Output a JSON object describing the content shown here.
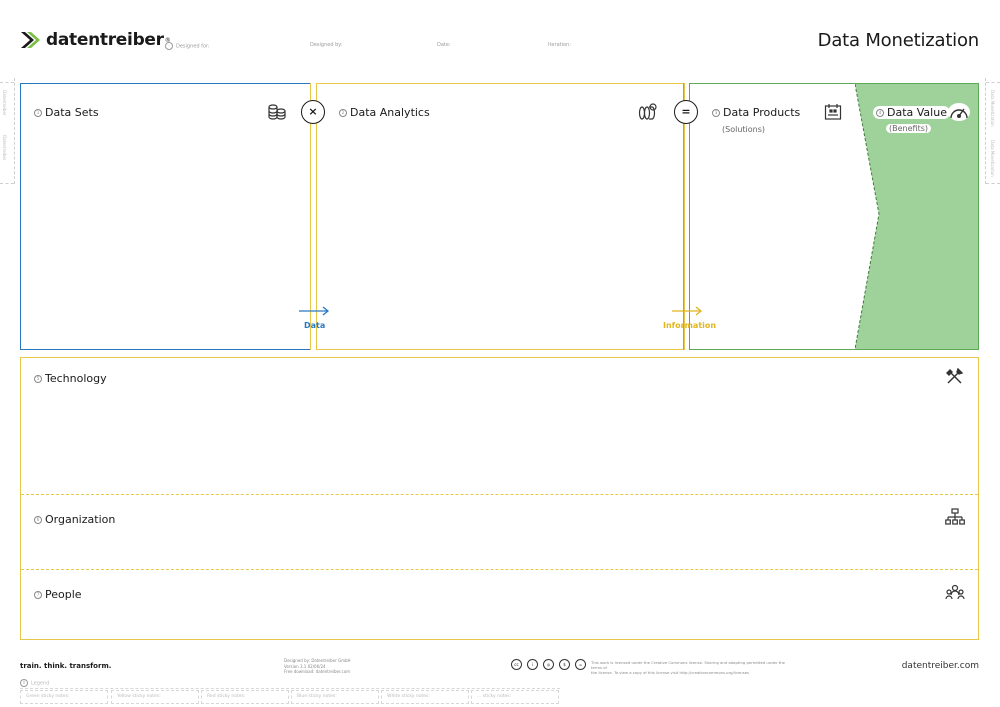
{
  "header": {
    "brand": "datentreiber",
    "brand_mark": "®",
    "title": "Data Monetization",
    "meta": [
      {
        "label": "Designed for:"
      },
      {
        "label": "Designed by:"
      },
      {
        "label": "Date:"
      },
      {
        "label": "Iteration:"
      }
    ]
  },
  "side": {
    "left_top": "Datentreiber",
    "left_bottom": "Datentreiber",
    "right_top": "Data Monetization",
    "right_bottom": "Data Monetization"
  },
  "canvas": {
    "data_sets": {
      "num": "1",
      "label": "Data Sets",
      "icon": "coins-stack-icon"
    },
    "operator_times": "×",
    "data_analytics": {
      "num": "2",
      "label": "Data Analytics",
      "icon": "analytics-icon"
    },
    "operator_equals": "=",
    "data_products": {
      "num": "3",
      "label": "Data Products",
      "sub": "(Solutions)",
      "icon": "calendar-icon"
    },
    "data_value": {
      "num": "4",
      "label": "Data Value",
      "sub": "(Benefits)",
      "icon": "speedometer-icon"
    },
    "flow_data": "Data",
    "flow_information": "Information",
    "technology": {
      "num": "5",
      "label": "Technology",
      "icon": "tools-icon"
    },
    "organization": {
      "num": "6",
      "label": "Organization",
      "icon": "org-chart-icon"
    },
    "people": {
      "num": "7",
      "label": "People",
      "icon": "people-icon"
    }
  },
  "colors": {
    "blue": "#2a78c2",
    "yellow": "#e6c84a",
    "green": "#5caa56",
    "green_fill": "#9fd29b"
  },
  "footer": {
    "tagline": "train. think. transform.",
    "credits": [
      "Designed by: Datentreiber GmbH",
      "Version 3.1 02/06/24",
      "Free download: datentreiber.com"
    ],
    "license": [
      "This work is licensed under the Creative Commons license. Sharing and adapting permitted under the terms of",
      "the license. To view a copy of this license visit http://creativecommons.org/licenses"
    ],
    "site": "datentreiber.com",
    "legend_num": "8",
    "legend_label": "Legend",
    "legend": [
      "Green sticky notes:",
      "Yellow sticky notes:",
      "Red sticky notes:",
      "Blue sticky notes:",
      "White sticky notes:",
      "... sticky notes:"
    ]
  }
}
